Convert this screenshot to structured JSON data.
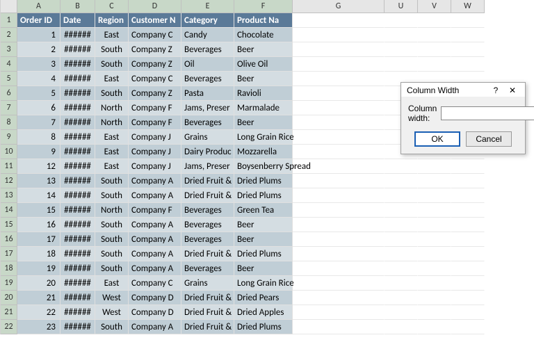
{
  "columns": [
    "A",
    "B",
    "C",
    "D",
    "E",
    "F",
    "G",
    "U",
    "V",
    "W"
  ],
  "selected_columns": [
    "A",
    "B",
    "C",
    "D",
    "E",
    "F"
  ],
  "header_row": {
    "A": "Order ID",
    "B": "Date",
    "C": "Region",
    "D": "Customer N",
    "E": "Category",
    "F": "Product Na"
  },
  "rows": [
    {
      "n": 1,
      "A": "1",
      "B": "######",
      "C": "East",
      "D": "Company C",
      "E": "Candy",
      "F": "Chocolate"
    },
    {
      "n": 2,
      "A": "2",
      "B": "######",
      "C": "South",
      "D": "Company Z",
      "E": "Beverages",
      "F": "Beer"
    },
    {
      "n": 3,
      "A": "3",
      "B": "######",
      "C": "South",
      "D": "Company Z",
      "E": "Oil",
      "F": "Olive Oil"
    },
    {
      "n": 4,
      "A": "4",
      "B": "######",
      "C": "East",
      "D": "Company C",
      "E": "Beverages",
      "F": "Beer"
    },
    {
      "n": 5,
      "A": "5",
      "B": "######",
      "C": "South",
      "D": "Company Z",
      "E": "Pasta",
      "F": "Ravioli"
    },
    {
      "n": 6,
      "A": "6",
      "B": "######",
      "C": "North",
      "D": "Company F",
      "E": "Jams, Preser",
      "F": "Marmalade"
    },
    {
      "n": 7,
      "A": "7",
      "B": "######",
      "C": "North",
      "D": "Company F",
      "E": "Beverages",
      "F": "Beer"
    },
    {
      "n": 8,
      "A": "8",
      "B": "######",
      "C": "East",
      "D": "Company J",
      "E": "Grains",
      "F": "Long Grain Rice"
    },
    {
      "n": 9,
      "A": "9",
      "B": "######",
      "C": "East",
      "D": "Company J",
      "E": "Dairy Produc",
      "F": "Mozzarella"
    },
    {
      "n": 10,
      "A": "12",
      "B": "######",
      "C": "East",
      "D": "Company J",
      "E": "Jams, Preser",
      "F": "Boysenberry Spread"
    },
    {
      "n": 11,
      "A": "13",
      "B": "######",
      "C": "South",
      "D": "Company A",
      "E": "Dried Fruit &",
      "F": "Dried Plums"
    },
    {
      "n": 12,
      "A": "14",
      "B": "######",
      "C": "South",
      "D": "Company A",
      "E": "Dried Fruit &",
      "F": "Dried Plums"
    },
    {
      "n": 13,
      "A": "15",
      "B": "######",
      "C": "North",
      "D": "Company F",
      "E": "Beverages",
      "F": "Green Tea"
    },
    {
      "n": 14,
      "A": "16",
      "B": "######",
      "C": "South",
      "D": "Company A",
      "E": "Beverages",
      "F": "Beer"
    },
    {
      "n": 15,
      "A": "17",
      "B": "######",
      "C": "South",
      "D": "Company A",
      "E": "Beverages",
      "F": "Beer"
    },
    {
      "n": 16,
      "A": "18",
      "B": "######",
      "C": "South",
      "D": "Company A",
      "E": "Dried Fruit &",
      "F": "Dried Plums"
    },
    {
      "n": 17,
      "A": "19",
      "B": "######",
      "C": "South",
      "D": "Company A",
      "E": "Beverages",
      "F": "Beer"
    },
    {
      "n": 18,
      "A": "20",
      "B": "######",
      "C": "East",
      "D": "Company C",
      "E": "Grains",
      "F": "Long Grain Rice"
    },
    {
      "n": 19,
      "A": "21",
      "B": "######",
      "C": "West",
      "D": "Company D",
      "E": "Dried Fruit &",
      "F": "Dried Pears"
    },
    {
      "n": 20,
      "A": "22",
      "B": "######",
      "C": "West",
      "D": "Company D",
      "E": "Dried Fruit &",
      "F": "Dried Apples"
    },
    {
      "n": 21,
      "A": "23",
      "B": "######",
      "C": "South",
      "D": "Company A",
      "E": "Dried Fruit &",
      "F": "Dried Plums"
    }
  ],
  "dialog": {
    "title": "Column Width",
    "help": "?",
    "close": "✕",
    "label": "Column width:",
    "value": "",
    "ok": "OK",
    "cancel": "Cancel"
  }
}
